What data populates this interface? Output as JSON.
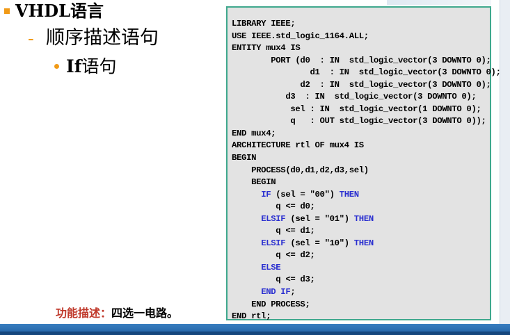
{
  "slide": {
    "title": "VHDL语言",
    "subtitle": "顺序描述语句",
    "topic": "If语句",
    "topic_bold": "If",
    "topic_rest": "语句",
    "func_label": "功能描述：",
    "func_text": "四选一电路。"
  },
  "code": {
    "lines": [
      "LIBRARY IEEE;",
      "USE IEEE.std_logic_1164.ALL;",
      "ENTITY mux4 IS",
      "        PORT (d0  : IN  std_logic_vector(3 DOWNTO 0);",
      "                d1  : IN  std_logic_vector(3 DOWNTO 0);",
      "              d2  : IN  std_logic_vector(3 DOWNTO 0);",
      "           d3  : IN  std_logic_vector(3 DOWNTO 0);",
      "            sel : IN  std_logic_vector(1 DOWNTO 0);",
      "            q   : OUT std_logic_vector(3 DOWNTO 0));",
      "END mux4;",
      "ARCHITECTURE rtl OF mux4 IS",
      "BEGIN",
      "    PROCESS(d0,d1,d2,d3,sel)",
      "    BEGIN",
      "      IF (sel = \"00\") THEN",
      "         q <= d0;",
      "      ELSIF (sel = \"01\") THEN",
      "         q <= d1;",
      "      ELSIF (sel = \"10\") THEN",
      "         q <= d2;",
      "      ELSE",
      "         q <= d3;",
      "      END IF;",
      "    END PROCESS;",
      "END rtl;"
    ],
    "keywords": [
      "IF",
      "ELSIF",
      "THEN",
      "ELSE",
      "END IF"
    ],
    "keyword_color": "#2a2fd0"
  },
  "colors": {
    "accent": "#f19a17",
    "func_label": "#c0392b",
    "code_border": "#3fa88d",
    "code_bg": "#e3e3e3",
    "bottom_bar": "#1f5fa3"
  }
}
